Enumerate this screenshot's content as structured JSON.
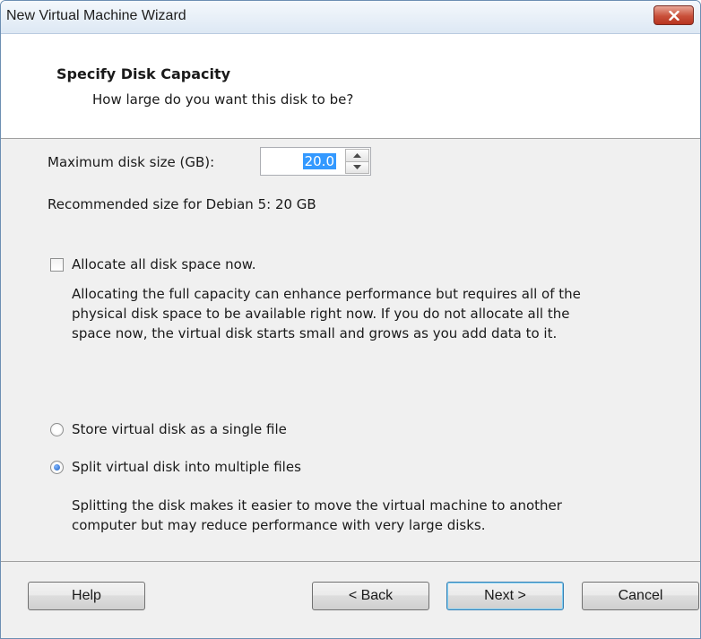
{
  "window": {
    "title": "New Virtual Machine Wizard"
  },
  "header": {
    "title": "Specify Disk Capacity",
    "subtitle": "How large do you want this disk to be?"
  },
  "disk": {
    "max_size_label": "Maximum disk size (GB):",
    "max_size_value": "20.0",
    "recommended": "Recommended size for Debian 5: 20 GB"
  },
  "allocate": {
    "checked": false,
    "label": "Allocate all disk space now.",
    "description_lines": [
      "Allocating the full capacity can enhance performance but requires all of the",
      "physical disk space to be available right now. If you do not allocate all the",
      "space now, the virtual disk starts small and grows as you add data to it."
    ]
  },
  "storage": {
    "selected": "split",
    "single_label": "Store virtual disk as a single file",
    "split_label": "Split virtual disk into multiple files",
    "split_description_lines": [
      "Splitting the disk makes it easier to move the virtual machine to another",
      "computer but may reduce performance with very large disks."
    ]
  },
  "buttons": {
    "help": "Help",
    "back": "< Back",
    "next": "Next >",
    "cancel": "Cancel"
  },
  "icons": {
    "close": "close-icon",
    "spin_up": "spin-up-arrow-icon",
    "spin_down": "spin-down-arrow-icon"
  },
  "colors": {
    "selection_highlight": "#3399ff",
    "close_button": "#c9503a",
    "default_button_border": "#3c7fb1"
  }
}
